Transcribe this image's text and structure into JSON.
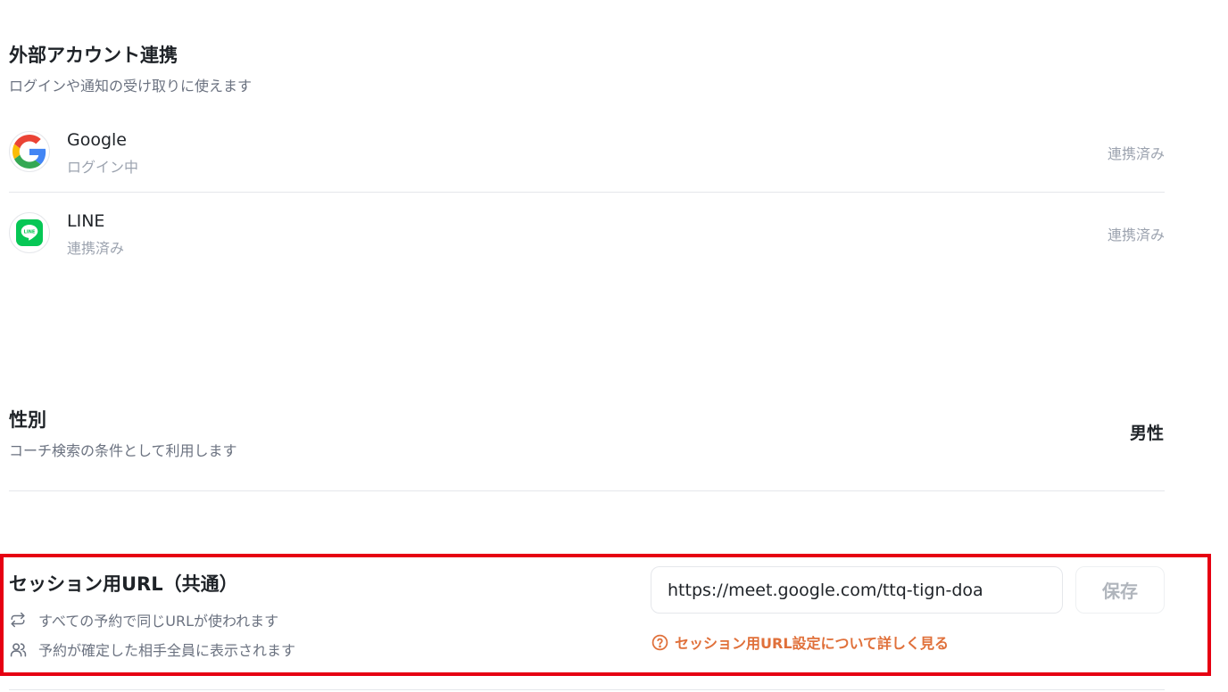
{
  "external_accounts": {
    "title": "外部アカウント連携",
    "description": "ログインや通知の受け取りに使えます",
    "accounts": [
      {
        "name": "Google",
        "sub": "ログイン中",
        "status": "連携済み",
        "icon": "google-icon"
      },
      {
        "name": "LINE",
        "sub": "連携済み",
        "status": "連携済み",
        "icon": "line-icon",
        "icon_text": "LINE",
        "brand_color": "#06c755"
      }
    ]
  },
  "gender": {
    "title": "性別",
    "description": "コーチ検索の条件として利用します",
    "value": "男性"
  },
  "session_url": {
    "title": "セッション用URL（共通）",
    "notes": [
      {
        "icon": "repeat-icon",
        "text": "すべての予約で同じURLが使われます"
      },
      {
        "icon": "users-icon",
        "text": "予約が確定した相手全員に表示されます"
      }
    ],
    "input_value": "https://meet.google.com/ttq-tign-doa",
    "save_label": "保存",
    "help_icon": "question-circle-icon",
    "help_link": "セッション用URL設定について詳しく見る",
    "link_color": "#e0703a",
    "highlight_color": "#e60012"
  }
}
